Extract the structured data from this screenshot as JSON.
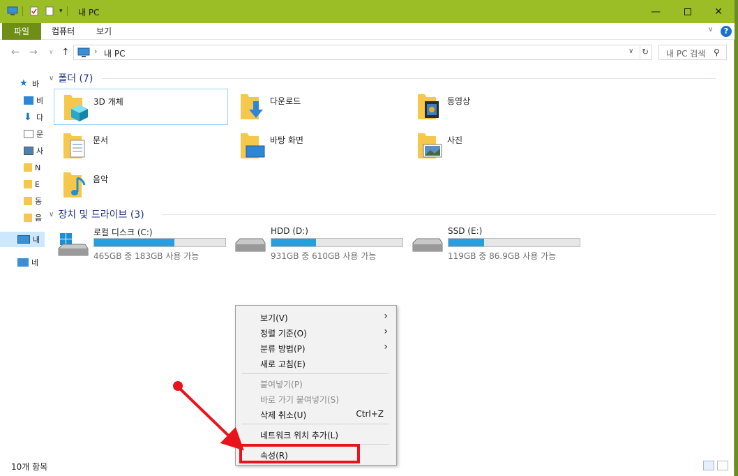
{
  "window": {
    "title": "내 PC"
  },
  "ribbon": {
    "tabs": [
      "파일",
      "컴퓨터",
      "보기"
    ]
  },
  "address": {
    "path": "내 PC",
    "search_placeholder": "내 PC 검색"
  },
  "navpane": {
    "items": [
      {
        "label": "바",
        "icon": "quick-access-star-icon"
      },
      {
        "label": "비",
        "icon": "desktop-icon"
      },
      {
        "label": "다",
        "icon": "downloads-icon"
      },
      {
        "label": "문",
        "icon": "documents-icon"
      },
      {
        "label": "사",
        "icon": "pictures-icon"
      },
      {
        "label": "N",
        "icon": "folder-icon"
      },
      {
        "label": "E",
        "icon": "folder-icon"
      },
      {
        "label": "동",
        "icon": "folder-icon"
      },
      {
        "label": "음",
        "icon": "folder-icon"
      },
      {
        "label": "내",
        "icon": "this-pc-icon"
      },
      {
        "label": "네",
        "icon": "network-icon"
      }
    ]
  },
  "folders": {
    "header": "폴더 (7)",
    "items": [
      {
        "label": "3D 개체",
        "icon": "3d-objects-folder-icon"
      },
      {
        "label": "다운로드",
        "icon": "downloads-folder-icon"
      },
      {
        "label": "동영상",
        "icon": "videos-folder-icon"
      },
      {
        "label": "문서",
        "icon": "documents-folder-icon"
      },
      {
        "label": "바탕 화면",
        "icon": "desktop-folder-icon"
      },
      {
        "label": "사진",
        "icon": "pictures-folder-icon"
      },
      {
        "label": "음악",
        "icon": "music-folder-icon"
      }
    ]
  },
  "drives": {
    "header": "장치 및 드라이브 (3)",
    "items": [
      {
        "name": "로컬 디스크 (C:)",
        "free": "465GB 중 183GB 사용 가능",
        "used_fraction": 0.61,
        "icon": "windows-drive-icon"
      },
      {
        "name": "HDD (D:)",
        "free": "931GB 중 610GB 사용 가능",
        "used_fraction": 0.34,
        "icon": "hard-drive-icon"
      },
      {
        "name": "SSD (E:)",
        "free": "119GB 중 86.9GB 사용 가능",
        "used_fraction": 0.27,
        "icon": "hard-drive-icon"
      }
    ]
  },
  "status": {
    "item_count": "10개 항목"
  },
  "context_menu": {
    "view": "보기(V)",
    "sort_by": "정렬 기준(O)",
    "group_by": "분류 방법(P)",
    "refresh": "새로 고침(E)",
    "paste": "붙여넣기(P)",
    "paste_shortcut": "바로 가기 붙여넣기(S)",
    "undo_delete": "삭제 취소(U)",
    "undo_shortcut": "Ctrl+Z",
    "add_network_location": "네트워크 위치 추가(L)",
    "properties": "속성(R)"
  },
  "colors": {
    "accent": "#9bbd25",
    "file_tab": "#6f8e15",
    "drive_fill": "#26a0da",
    "annotation": "#e8141b"
  }
}
